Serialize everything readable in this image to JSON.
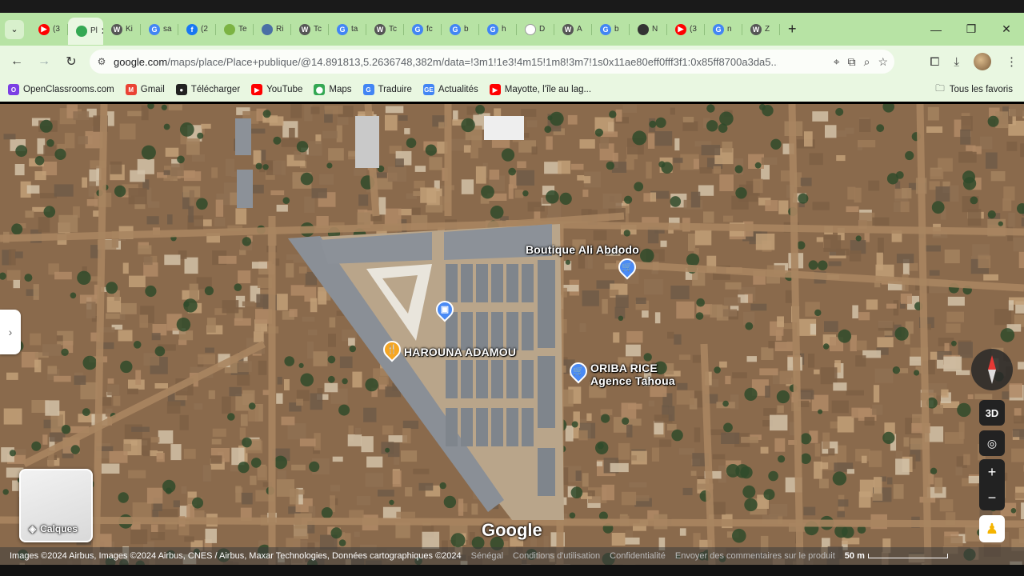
{
  "tabs": [
    {
      "label": "(3",
      "color": "#ff0000",
      "glyph": "▶"
    },
    {
      "label": "Pl",
      "color": "#34a853",
      "glyph": "",
      "active": true
    },
    {
      "label": "Ki",
      "color": "#555555",
      "glyph": "W"
    },
    {
      "label": "sa",
      "color": "#4285f4",
      "glyph": "G"
    },
    {
      "label": "(2",
      "color": "#1877f2",
      "glyph": "f"
    },
    {
      "label": "Te",
      "color": "#7cb342",
      "glyph": ""
    },
    {
      "label": "Ri",
      "color": "#4a6fa5",
      "glyph": ""
    },
    {
      "label": "Tc",
      "color": "#555555",
      "glyph": "W"
    },
    {
      "label": "ta",
      "color": "#4285f4",
      "glyph": "G"
    },
    {
      "label": "Tc",
      "color": "#555555",
      "glyph": "W"
    },
    {
      "label": "fc",
      "color": "#4285f4",
      "glyph": "G"
    },
    {
      "label": "b",
      "color": "#4285f4",
      "glyph": "G"
    },
    {
      "label": "h",
      "color": "#4285f4",
      "glyph": "G"
    },
    {
      "label": "D",
      "color": "#ffffff",
      "glyph": ""
    },
    {
      "label": "A",
      "color": "#555555",
      "glyph": "W"
    },
    {
      "label": "b",
      "color": "#4285f4",
      "glyph": "G"
    },
    {
      "label": "N",
      "color": "#333333",
      "glyph": ""
    },
    {
      "label": "(3",
      "color": "#ff0000",
      "glyph": "▶"
    },
    {
      "label": "n",
      "color": "#4285f4",
      "glyph": "G"
    },
    {
      "label": "Z",
      "color": "#555555",
      "glyph": "W"
    }
  ],
  "url": {
    "host": "google.com",
    "path": "/maps/place/Place+publique/@14.891813,5.2636748,382m/data=!3m1!1e3!4m15!1m8!3m7!1s0x11ae80eff0fff3f1:0x85ff8700a3da5..."
  },
  "bookmarks": [
    {
      "label": "OpenClassrooms.com",
      "color": "#7b3fe4",
      "glyph": "O"
    },
    {
      "label": "Gmail",
      "color": "#ea4335",
      "glyph": "M"
    },
    {
      "label": "Télécharger",
      "color": "#222222",
      "glyph": "●"
    },
    {
      "label": "YouTube",
      "color": "#ff0000",
      "glyph": "▶"
    },
    {
      "label": "Maps",
      "color": "#34a853",
      "glyph": "⬤"
    },
    {
      "label": "Traduire",
      "color": "#4285f4",
      "glyph": "G"
    },
    {
      "label": "Actualités",
      "color": "#4285f4",
      "glyph": "GE"
    },
    {
      "label": "Mayotte, l'île au lag...",
      "color": "#ff0000",
      "glyph": "▶"
    }
  ],
  "bookmarks_right": "Tous les favoris",
  "map": {
    "places": [
      {
        "name": "Boutique Ali Abdodo",
        "type": "shop"
      },
      {
        "name": "HAROUNA ADAMOU",
        "type": "restaurant"
      },
      {
        "name": "ORIBA RICE",
        "subtitle": "Agence Tahoua",
        "type": "shop"
      }
    ],
    "layers_label": "Calques",
    "btn_3d": "3D",
    "logo": "Google"
  },
  "footer": {
    "attribution": "Images ©2024 Airbus, Images ©2024 Airbus, CNES / Airbus, Maxar Technologies, Données cartographiques ©2024",
    "country": "Sénégal",
    "terms": "Conditions d'utilisation",
    "privacy": "Confidentialité",
    "feedback": "Envoyer des commentaires sur le produit",
    "scale": "50 m"
  },
  "colors": {
    "tabstrip": "#b7e3a4",
    "toolbar": "#e9f7e1",
    "pin_blue": "#4a8af4",
    "pin_orange": "#f5a623"
  }
}
